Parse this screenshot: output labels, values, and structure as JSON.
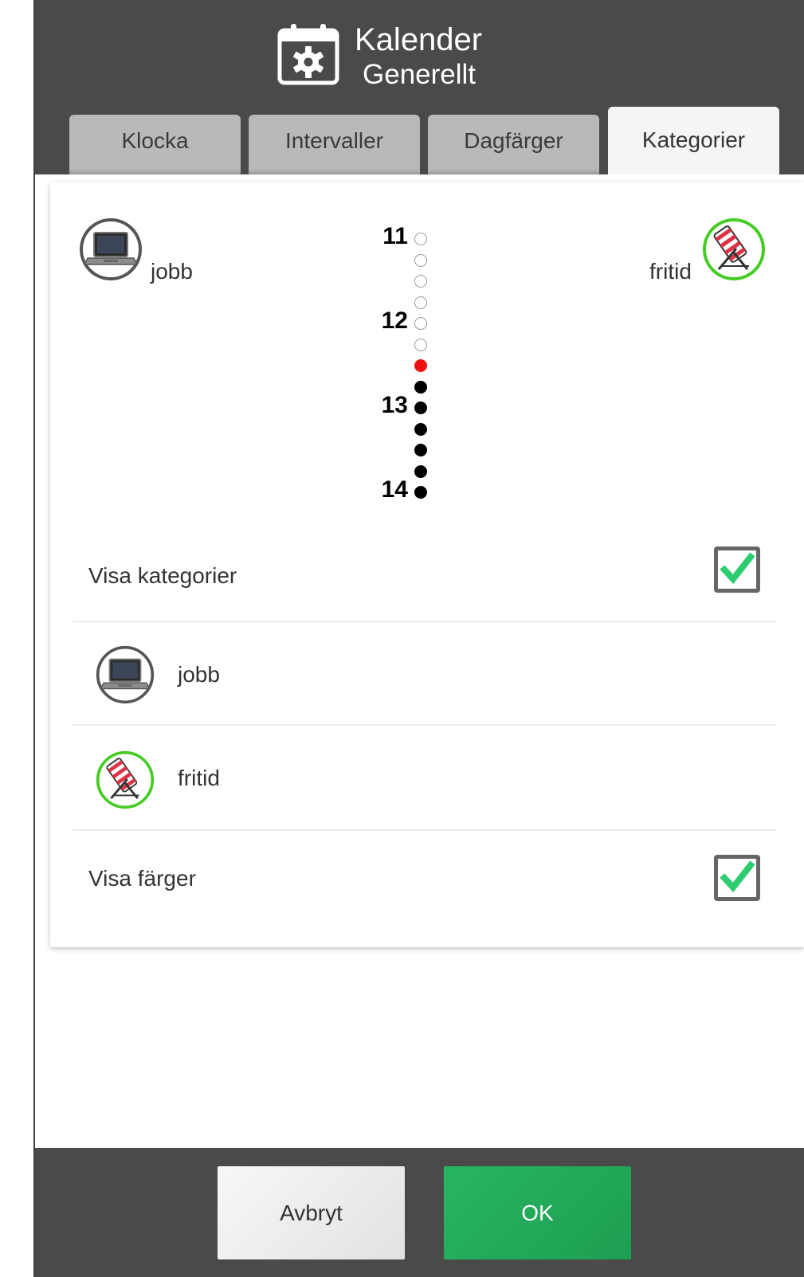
{
  "header": {
    "title": "Kalender",
    "subtitle": "Generellt",
    "icon": "calendar-settings-icon"
  },
  "tabs": [
    {
      "label": "Klocka",
      "active": false
    },
    {
      "label": "Intervaller",
      "active": false
    },
    {
      "label": "Dagfärger",
      "active": false
    },
    {
      "label": "Kategorier",
      "active": true
    }
  ],
  "preview": {
    "left_category": {
      "label": "jobb",
      "icon": "laptop-icon"
    },
    "right_category": {
      "label": "fritid",
      "icon": "deck-chair-icon"
    },
    "timeline_hours": [
      "11",
      "12",
      "13",
      "14"
    ],
    "timeline_dots": [
      "empty",
      "empty",
      "empty",
      "empty",
      "empty",
      "empty",
      "red",
      "black",
      "black",
      "black",
      "black",
      "black",
      "black"
    ]
  },
  "settings": {
    "show_categories": {
      "label": "Visa kategorier",
      "checked": true
    },
    "categories": [
      {
        "label": "jobb",
        "icon": "laptop-icon",
        "ring_color": "#555555"
      },
      {
        "label": "fritid",
        "icon": "deck-chair-icon",
        "ring_color": "#44cc22"
      }
    ],
    "show_colors": {
      "label": "Visa färger",
      "checked": true
    }
  },
  "footer": {
    "cancel_label": "Avbryt",
    "ok_label": "OK"
  },
  "colors": {
    "header_bg": "#4a4a4a",
    "ok_green": "#22aa58",
    "check_green": "#2ecc71",
    "timeline_now": "#ee1111"
  }
}
